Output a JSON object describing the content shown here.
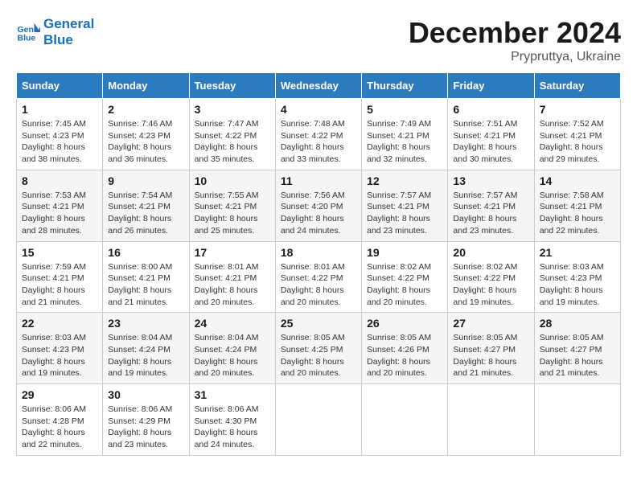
{
  "header": {
    "logo_line1": "General",
    "logo_line2": "Blue",
    "month_title": "December 2024",
    "location": "Prypruttya, Ukraine"
  },
  "weekdays": [
    "Sunday",
    "Monday",
    "Tuesday",
    "Wednesday",
    "Thursday",
    "Friday",
    "Saturday"
  ],
  "weeks": [
    [
      {
        "day": "1",
        "info": "Sunrise: 7:45 AM\nSunset: 4:23 PM\nDaylight: 8 hours\nand 38 minutes."
      },
      {
        "day": "2",
        "info": "Sunrise: 7:46 AM\nSunset: 4:23 PM\nDaylight: 8 hours\nand 36 minutes."
      },
      {
        "day": "3",
        "info": "Sunrise: 7:47 AM\nSunset: 4:22 PM\nDaylight: 8 hours\nand 35 minutes."
      },
      {
        "day": "4",
        "info": "Sunrise: 7:48 AM\nSunset: 4:22 PM\nDaylight: 8 hours\nand 33 minutes."
      },
      {
        "day": "5",
        "info": "Sunrise: 7:49 AM\nSunset: 4:21 PM\nDaylight: 8 hours\nand 32 minutes."
      },
      {
        "day": "6",
        "info": "Sunrise: 7:51 AM\nSunset: 4:21 PM\nDaylight: 8 hours\nand 30 minutes."
      },
      {
        "day": "7",
        "info": "Sunrise: 7:52 AM\nSunset: 4:21 PM\nDaylight: 8 hours\nand 29 minutes."
      }
    ],
    [
      {
        "day": "8",
        "info": "Sunrise: 7:53 AM\nSunset: 4:21 PM\nDaylight: 8 hours\nand 28 minutes."
      },
      {
        "day": "9",
        "info": "Sunrise: 7:54 AM\nSunset: 4:21 PM\nDaylight: 8 hours\nand 26 minutes."
      },
      {
        "day": "10",
        "info": "Sunrise: 7:55 AM\nSunset: 4:21 PM\nDaylight: 8 hours\nand 25 minutes."
      },
      {
        "day": "11",
        "info": "Sunrise: 7:56 AM\nSunset: 4:20 PM\nDaylight: 8 hours\nand 24 minutes."
      },
      {
        "day": "12",
        "info": "Sunrise: 7:57 AM\nSunset: 4:21 PM\nDaylight: 8 hours\nand 23 minutes."
      },
      {
        "day": "13",
        "info": "Sunrise: 7:57 AM\nSunset: 4:21 PM\nDaylight: 8 hours\nand 23 minutes."
      },
      {
        "day": "14",
        "info": "Sunrise: 7:58 AM\nSunset: 4:21 PM\nDaylight: 8 hours\nand 22 minutes."
      }
    ],
    [
      {
        "day": "15",
        "info": "Sunrise: 7:59 AM\nSunset: 4:21 PM\nDaylight: 8 hours\nand 21 minutes."
      },
      {
        "day": "16",
        "info": "Sunrise: 8:00 AM\nSunset: 4:21 PM\nDaylight: 8 hours\nand 21 minutes."
      },
      {
        "day": "17",
        "info": "Sunrise: 8:01 AM\nSunset: 4:21 PM\nDaylight: 8 hours\nand 20 minutes."
      },
      {
        "day": "18",
        "info": "Sunrise: 8:01 AM\nSunset: 4:22 PM\nDaylight: 8 hours\nand 20 minutes."
      },
      {
        "day": "19",
        "info": "Sunrise: 8:02 AM\nSunset: 4:22 PM\nDaylight: 8 hours\nand 20 minutes."
      },
      {
        "day": "20",
        "info": "Sunrise: 8:02 AM\nSunset: 4:22 PM\nDaylight: 8 hours\nand 19 minutes."
      },
      {
        "day": "21",
        "info": "Sunrise: 8:03 AM\nSunset: 4:23 PM\nDaylight: 8 hours\nand 19 minutes."
      }
    ],
    [
      {
        "day": "22",
        "info": "Sunrise: 8:03 AM\nSunset: 4:23 PM\nDaylight: 8 hours\nand 19 minutes."
      },
      {
        "day": "23",
        "info": "Sunrise: 8:04 AM\nSunset: 4:24 PM\nDaylight: 8 hours\nand 19 minutes."
      },
      {
        "day": "24",
        "info": "Sunrise: 8:04 AM\nSunset: 4:24 PM\nDaylight: 8 hours\nand 20 minutes."
      },
      {
        "day": "25",
        "info": "Sunrise: 8:05 AM\nSunset: 4:25 PM\nDaylight: 8 hours\nand 20 minutes."
      },
      {
        "day": "26",
        "info": "Sunrise: 8:05 AM\nSunset: 4:26 PM\nDaylight: 8 hours\nand 20 minutes."
      },
      {
        "day": "27",
        "info": "Sunrise: 8:05 AM\nSunset: 4:27 PM\nDaylight: 8 hours\nand 21 minutes."
      },
      {
        "day": "28",
        "info": "Sunrise: 8:05 AM\nSunset: 4:27 PM\nDaylight: 8 hours\nand 21 minutes."
      }
    ],
    [
      {
        "day": "29",
        "info": "Sunrise: 8:06 AM\nSunset: 4:28 PM\nDaylight: 8 hours\nand 22 minutes."
      },
      {
        "day": "30",
        "info": "Sunrise: 8:06 AM\nSunset: 4:29 PM\nDaylight: 8 hours\nand 23 minutes."
      },
      {
        "day": "31",
        "info": "Sunrise: 8:06 AM\nSunset: 4:30 PM\nDaylight: 8 hours\nand 24 minutes."
      },
      null,
      null,
      null,
      null
    ]
  ]
}
